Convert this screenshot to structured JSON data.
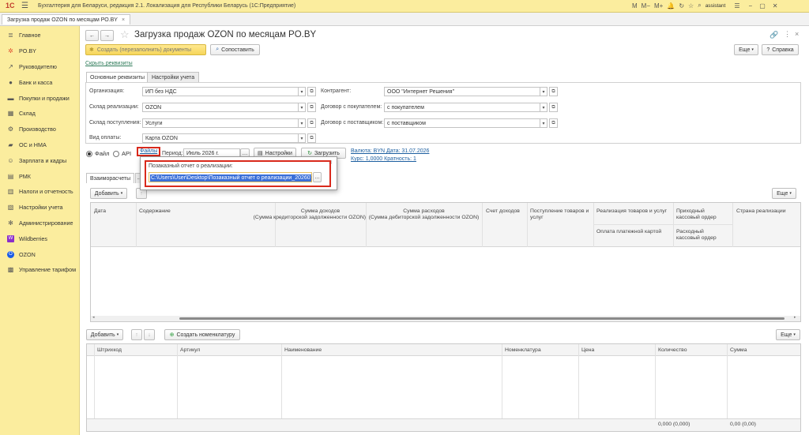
{
  "app": {
    "title": "Бухгалтерия для Беларуси, редакция 2.1. Локализация для Республики Беларусь (1С:Предприятие)",
    "user": "assistant",
    "logo": "1С"
  },
  "tabs": [
    {
      "label": "Загрузка продаж OZON по месяцам РО.BY"
    }
  ],
  "sidebar": {
    "items": [
      {
        "label": "Главное",
        "icon": "menu"
      },
      {
        "label": "PO.BY",
        "icon": "star"
      },
      {
        "label": "Руководителю",
        "icon": "chart"
      },
      {
        "label": "Банк и касса",
        "icon": "bank"
      },
      {
        "label": "Покупки и продажи",
        "icon": "cart"
      },
      {
        "label": "Склад",
        "icon": "warehouse"
      },
      {
        "label": "Производство",
        "icon": "factory"
      },
      {
        "label": "ОС и НМА",
        "icon": "truck"
      },
      {
        "label": "Зарплата и кадры",
        "icon": "people"
      },
      {
        "label": "РМК",
        "icon": "register"
      },
      {
        "label": "Налоги и отчетность",
        "icon": "tax"
      },
      {
        "label": "Настройки учета",
        "icon": "settings"
      },
      {
        "label": "Администрирование",
        "icon": "gear"
      },
      {
        "label": "Wildberries",
        "icon": "wb"
      },
      {
        "label": "OZON",
        "icon": "ozon"
      },
      {
        "label": "Управление тарифом",
        "icon": "tariff"
      }
    ]
  },
  "form": {
    "title": "Загрузка продаж OZON по месяцам PO.BY",
    "create_docs_label": "Создать (перезаполнить) документы",
    "compare_label": "Сопоставить",
    "more_label": "Еще",
    "help_label": "Справка",
    "hide_props_link": "Скрыть реквизиты",
    "prop_tabs": [
      "Основные реквизиты",
      "Настройки учета"
    ],
    "fields": {
      "org_label": "Организация:",
      "org_value": "ИП без НДС",
      "stock_out_label": "Склад реализации:",
      "stock_out_value": "OZON",
      "stock_in_label": "Склад поступления:",
      "stock_in_value": "Услуги",
      "pay_label": "Вид оплаты:",
      "pay_value": "Карта OZON",
      "contractor_label": "Контрагент:",
      "contractor_value": "ООО \"Интернет Решения\"",
      "buyer_contract_label": "Договор с покупателем:",
      "buyer_contract_value": "с покупателем",
      "supplier_contract_label": "Договор с поставщиком:",
      "supplier_contract_value": "с поставщиком"
    },
    "source": {
      "file_radio": "Файл",
      "api_radio": "API",
      "files_link": "Файлы",
      "period_label": "Период:",
      "period_value": "Июль 2026 г.",
      "settings_label": "Настройки",
      "load_label": "Загрузить",
      "currency_link": "Валюта: BYN Дата: 31.07.2026",
      "rate_link": "Курс: 1,0000 Кратность: 1"
    },
    "popup": {
      "label": "Позаказный отчет о реализации:",
      "path": "C:\\Users\\User\\Desktop\\Позаказный отчет о реализации_202607...",
      "close": "×"
    },
    "lower_tabs": [
      "Взаиморасчеты",
      "..."
    ],
    "add_label": "Добавить",
    "table1": {
      "columns": {
        "date": "Дата",
        "content": "Содержание",
        "income_1": "Сумма доходов",
        "income_2": "(Сумма кредиторской задолженности OZON)",
        "expense_1": "Сумма расходов",
        "expense_2": "(Сумма дебиторской задолженности OZON)",
        "income_acc": "Счет доходов",
        "receipt_1": "Поступление товаров и",
        "receipt_2": "услуг",
        "sales": "Реализация товаров и услуг",
        "card_pay": "Оплата платежной картой",
        "pko_1": "Приходный",
        "pko_2": "кассовый ордер",
        "rko_1": "Расходный",
        "rko_2": "кассовый ордер",
        "country": "Страна реализации"
      }
    },
    "create_nom_label": "Создать номенклатуру",
    "table2": {
      "columns": {
        "barcode": "Штрихкод",
        "article": "Артикул",
        "name": "Наименование",
        "nomenclature": "Номенклатура",
        "price": "Цена",
        "qty": "Количество",
        "sum": "Сумма"
      },
      "total_qty": "0,000 (0,000)",
      "total_sum": "0,00 (0,00)"
    }
  }
}
